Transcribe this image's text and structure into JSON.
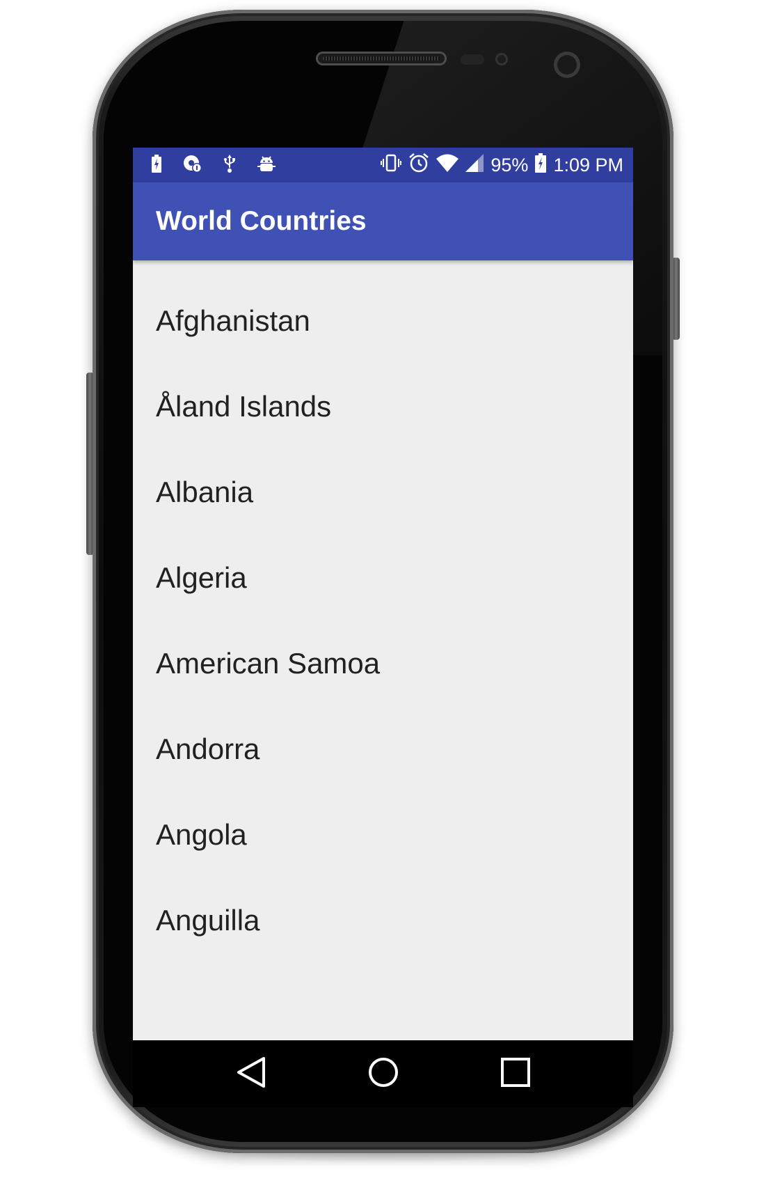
{
  "status_bar": {
    "battery_percent": "95%",
    "time": "1:09 PM",
    "left_icons": [
      "battery-charging-icon",
      "data-saver-icon",
      "usb-icon",
      "android-debug-icon"
    ],
    "right_icons": [
      "vibrate-icon",
      "alarm-icon",
      "wifi-icon",
      "cell-signal-icon",
      "battery-icon"
    ]
  },
  "app_bar": {
    "title": "World Countries"
  },
  "countries": [
    "Afghanistan",
    "Åland Islands",
    "Albania",
    "Algeria",
    "American Samoa",
    "Andorra",
    "Angola",
    "Anguilla"
  ],
  "navigation": {
    "icons": [
      "back-icon",
      "home-icon",
      "recents-icon"
    ]
  },
  "colors": {
    "status_bar": "#303f9f",
    "app_bar": "#3f51b5",
    "list_background": "#eeeeee",
    "list_text": "#212121"
  }
}
